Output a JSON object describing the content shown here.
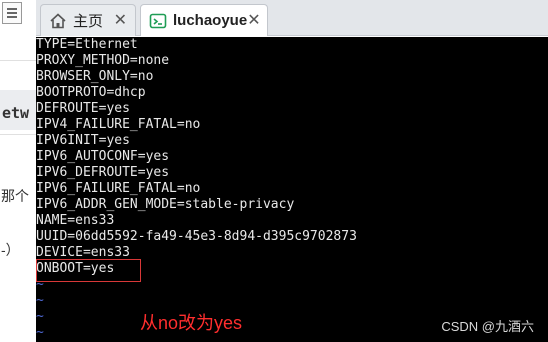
{
  "tabs": [
    {
      "label": "主页",
      "icon": "home-icon",
      "active": false
    },
    {
      "label": "luchaoyue",
      "icon": "terminal-icon",
      "active": true
    }
  ],
  "close_glyph": "✕",
  "background_fragments": {
    "heading_fragment": "etw",
    "text_fragment_1": "那个",
    "text_fragment_2": "-）"
  },
  "terminal": {
    "lines": [
      "TYPE=Ethernet",
      "PROXY_METHOD=none",
      "BROWSER_ONLY=no",
      "BOOTPROTO=dhcp",
      "DEFROUTE=yes",
      "IPV4_FAILURE_FATAL=no",
      "IPV6INIT=yes",
      "IPV6_AUTOCONF=yes",
      "IPV6_DEFROUTE=yes",
      "IPV6_FAILURE_FATAL=no",
      "IPV6_ADDR_GEN_MODE=stable-privacy",
      "NAME=ens33",
      "UUID=06dd5592-fa49-45e3-8d94-d395c9702873",
      "DEVICE=ens33",
      "ONBOOT=yes"
    ],
    "tildes": [
      "~",
      "~",
      "~",
      "~"
    ]
  },
  "annotation": "从no改为yes",
  "watermark": "CSDN @九酒六",
  "colors": {
    "terminal_bg": "#000000",
    "terminal_text": "#e8e8e8",
    "tilde": "#4f6ad6",
    "annotation": "#ff2e2e",
    "highlight_border": "#d83838"
  }
}
